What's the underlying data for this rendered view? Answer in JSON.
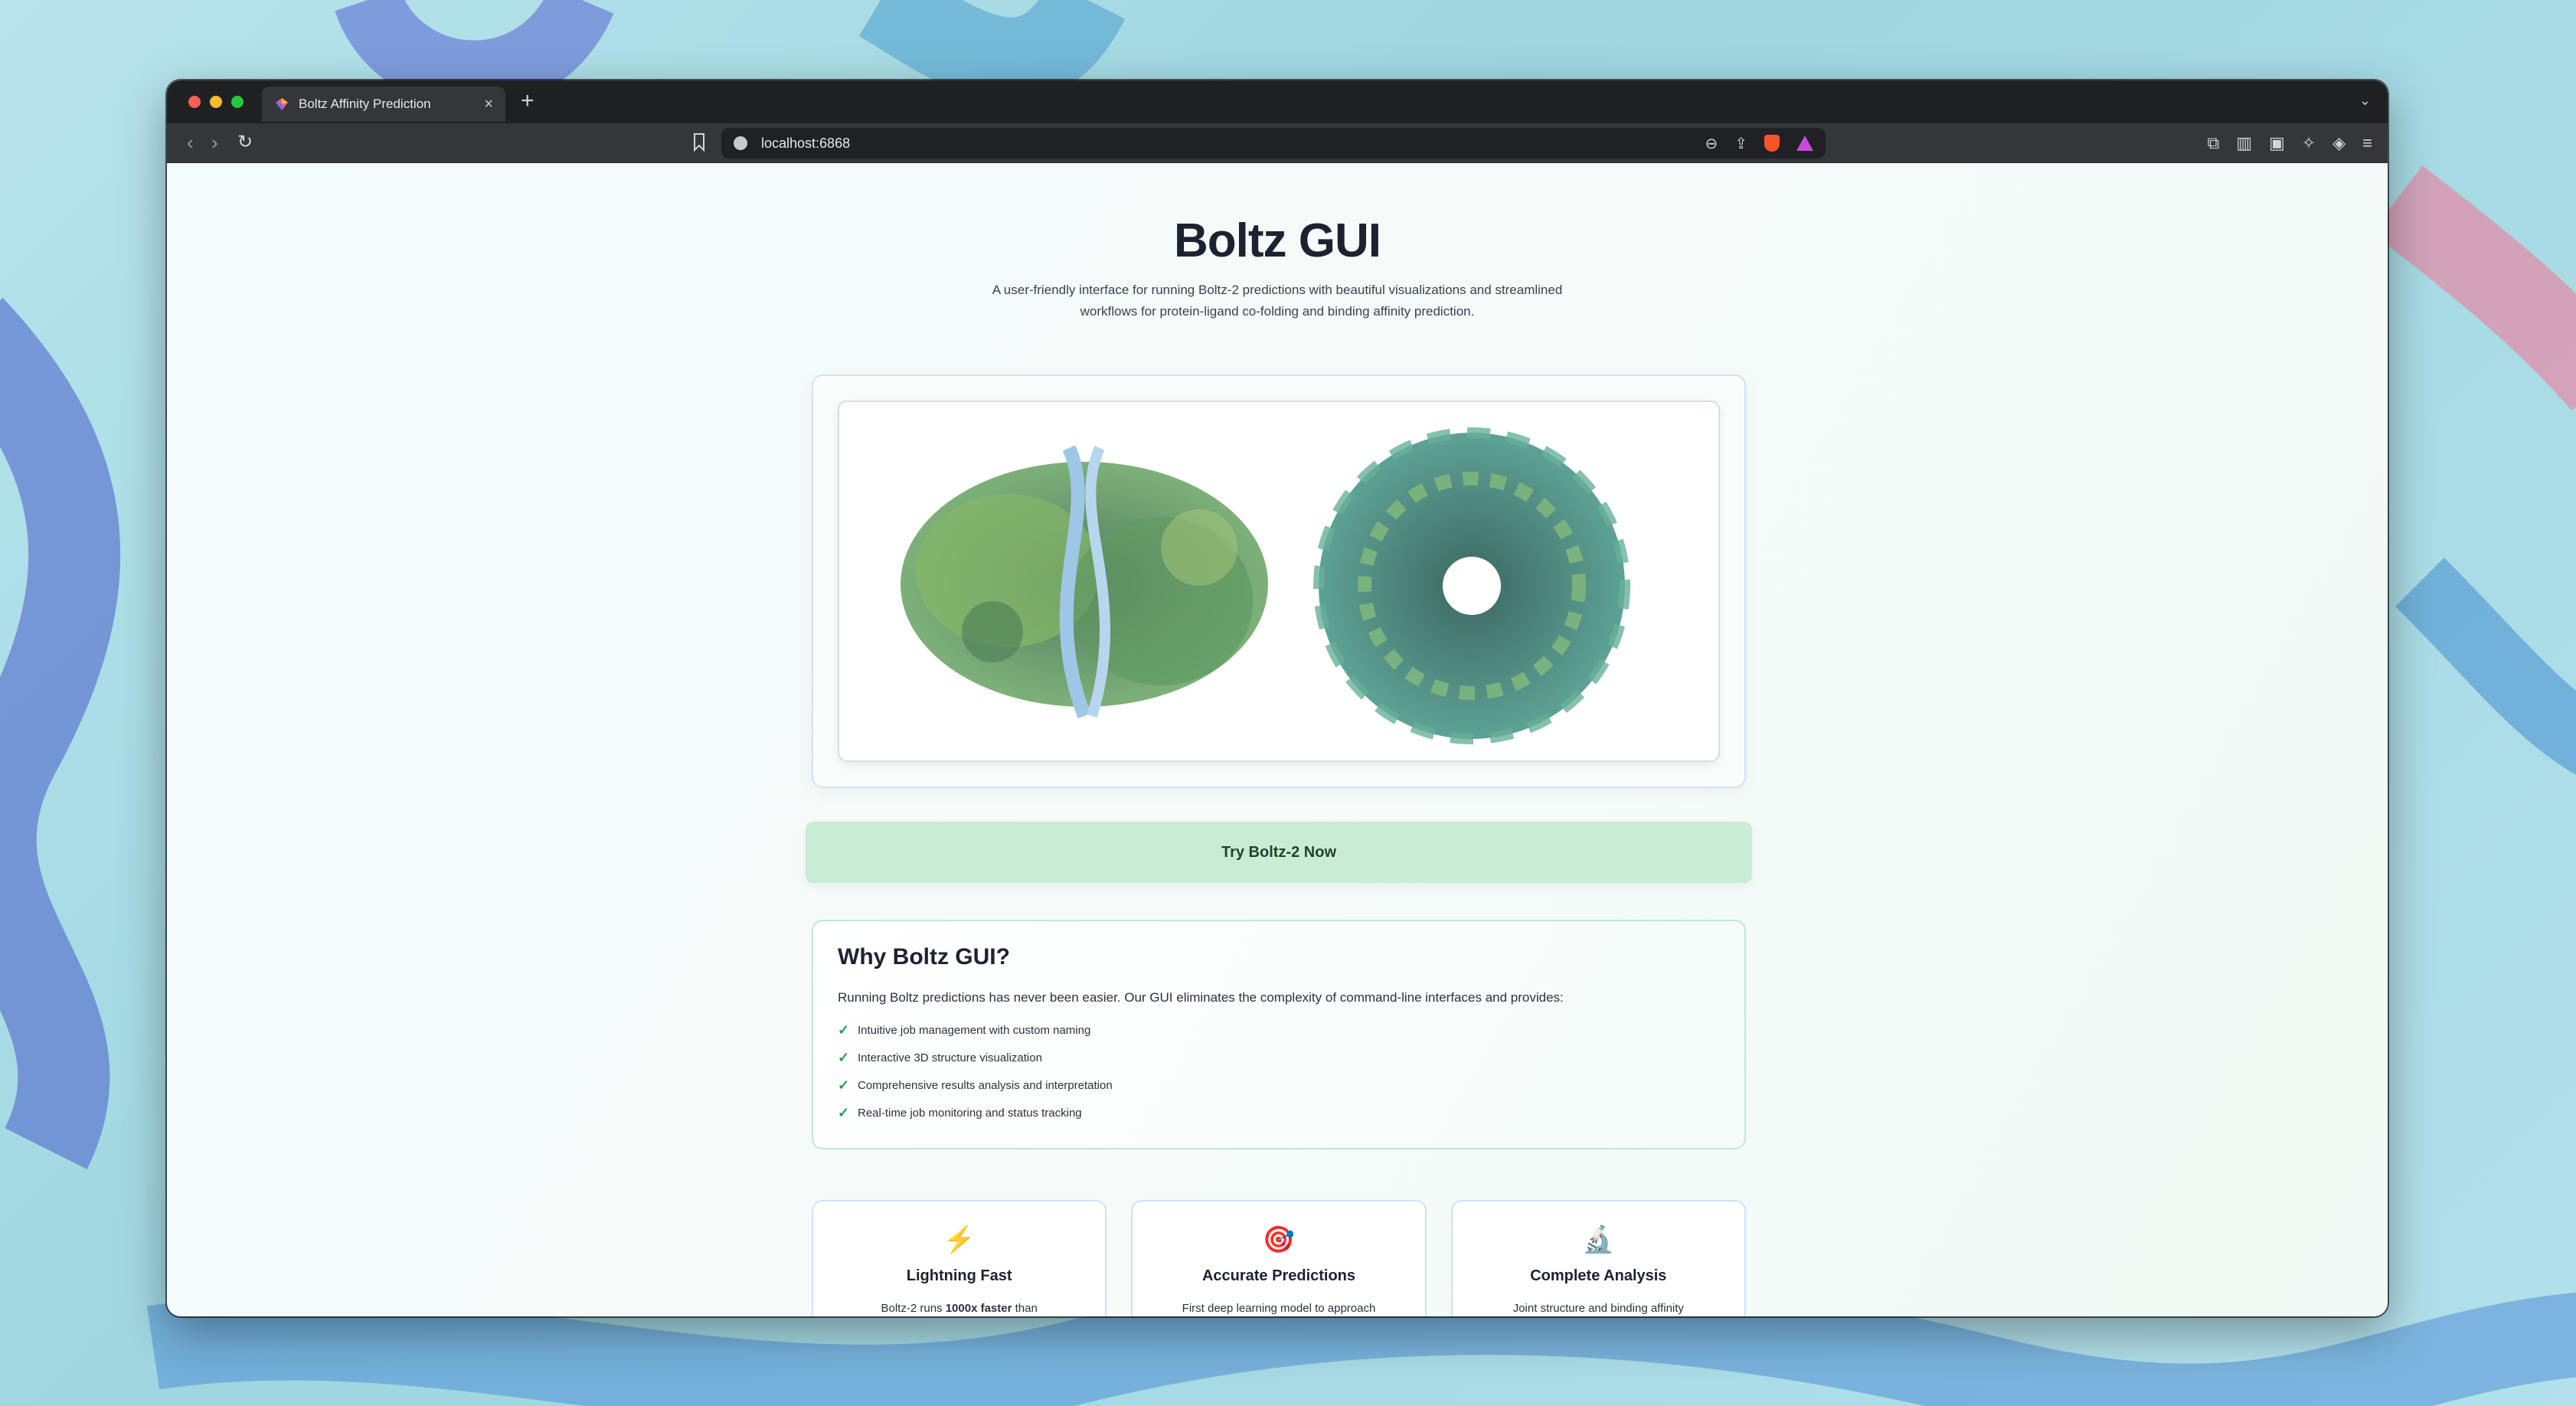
{
  "browser": {
    "tab_title": "Boltz Affinity Prediction",
    "new_tab_symbol": "+",
    "url": "localhost:6868"
  },
  "page": {
    "title": "Boltz GUI",
    "subtitle": "A user-friendly interface for running Boltz-2 predictions with beautiful visualizations and streamlined workflows for protein-ligand co-folding and binding affinity prediction.",
    "cta_label": "Try Boltz-2 Now"
  },
  "why": {
    "title": "Why Boltz GUI?",
    "intro": "Running Boltz predictions has never been easier. Our GUI eliminates the complexity of command-line interfaces and provides:",
    "items": [
      "Intuitive job management with custom naming",
      "Interactive 3D structure visualization",
      "Comprehensive results analysis and interpretation",
      "Real-time job monitoring and status tracking"
    ]
  },
  "features": [
    {
      "icon": "lightning-icon",
      "glyph": "⚡",
      "title": "Lightning Fast",
      "desc_pre": "Boltz-2 runs ",
      "desc_bold": "1000x faster",
      "desc_post": " than"
    },
    {
      "icon": "target-icon",
      "glyph": "🎯",
      "title": "Accurate Predictions",
      "desc_pre": "First deep learning model to approach",
      "desc_bold": "",
      "desc_post": ""
    },
    {
      "icon": "microscope-icon",
      "glyph": "🔬",
      "title": "Complete Analysis",
      "desc_pre": "Joint structure and binding affinity",
      "desc_bold": "",
      "desc_post": ""
    }
  ],
  "colors": {
    "accent_green": "#c9ecd4",
    "check_green": "#22a047",
    "title_text": "#1e2230"
  }
}
